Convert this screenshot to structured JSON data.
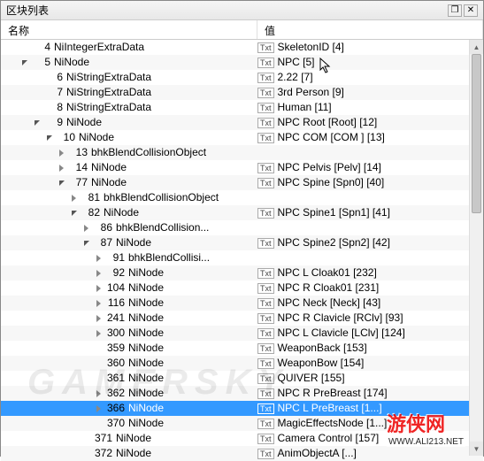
{
  "window": {
    "title": "区块列表"
  },
  "columns": {
    "name": "名称",
    "value": "值"
  },
  "rows": [
    {
      "depth": 1,
      "expand": "none",
      "num": "4",
      "name": "NiIntegerExtraData",
      "tag": "Txt",
      "value": "SkeletonID [4]"
    },
    {
      "depth": 1,
      "expand": "open",
      "num": "5",
      "name": "NiNode",
      "tag": "Txt",
      "value": "NPC [5]"
    },
    {
      "depth": 2,
      "expand": "none",
      "num": "6",
      "name": "NiStringExtraData",
      "tag": "Txt",
      "value": "2.22 [7]"
    },
    {
      "depth": 2,
      "expand": "none",
      "num": "7",
      "name": "NiStringExtraData",
      "tag": "Txt",
      "value": "3rd Person [9]"
    },
    {
      "depth": 2,
      "expand": "none",
      "num": "8",
      "name": "NiStringExtraData",
      "tag": "Txt",
      "value": "Human [11]"
    },
    {
      "depth": 2,
      "expand": "open",
      "num": "9",
      "name": "NiNode",
      "tag": "Txt",
      "value": "NPC Root [Root] [12]"
    },
    {
      "depth": 3,
      "expand": "open",
      "num": "10",
      "name": "NiNode",
      "tag": "Txt",
      "value": "NPC COM [COM ] [13]"
    },
    {
      "depth": 4,
      "expand": "closed",
      "num": "13",
      "name": "bhkBlendCollisionObject",
      "tag": "",
      "value": ""
    },
    {
      "depth": 4,
      "expand": "closed",
      "num": "14",
      "name": "NiNode",
      "tag": "Txt",
      "value": "NPC Pelvis [Pelv] [14]"
    },
    {
      "depth": 4,
      "expand": "open",
      "num": "77",
      "name": "NiNode",
      "tag": "Txt",
      "value": "NPC Spine [Spn0] [40]"
    },
    {
      "depth": 5,
      "expand": "closed",
      "num": "81",
      "name": "bhkBlendCollisionObject",
      "tag": "",
      "value": ""
    },
    {
      "depth": 5,
      "expand": "open",
      "num": "82",
      "name": "NiNode",
      "tag": "Txt",
      "value": "NPC Spine1 [Spn1] [41]"
    },
    {
      "depth": 6,
      "expand": "closed",
      "num": "86",
      "name": "bhkBlendCollision...",
      "tag": "",
      "value": ""
    },
    {
      "depth": 6,
      "expand": "open",
      "num": "87",
      "name": "NiNode",
      "tag": "Txt",
      "value": "NPC Spine2 [Spn2] [42]"
    },
    {
      "depth": 7,
      "expand": "closed",
      "num": "91",
      "name": "bhkBlendCollisi...",
      "tag": "",
      "value": ""
    },
    {
      "depth": 7,
      "expand": "closed",
      "num": "92",
      "name": "NiNode",
      "tag": "Txt",
      "value": "NPC L Cloak01 [232]"
    },
    {
      "depth": 7,
      "expand": "closed",
      "num": "104",
      "name": "NiNode",
      "tag": "Txt",
      "value": "NPC R Cloak01 [231]"
    },
    {
      "depth": 7,
      "expand": "closed",
      "num": "116",
      "name": "NiNode",
      "tag": "Txt",
      "value": "NPC Neck [Neck] [43]"
    },
    {
      "depth": 7,
      "expand": "closed",
      "num": "241",
      "name": "NiNode",
      "tag": "Txt",
      "value": "NPC R Clavicle [RClv] [93]"
    },
    {
      "depth": 7,
      "expand": "closed",
      "num": "300",
      "name": "NiNode",
      "tag": "Txt",
      "value": "NPC L Clavicle [LClv] [124]"
    },
    {
      "depth": 7,
      "expand": "none",
      "num": "359",
      "name": "NiNode",
      "tag": "Txt",
      "value": "WeaponBack [153]"
    },
    {
      "depth": 7,
      "expand": "none",
      "num": "360",
      "name": "NiNode",
      "tag": "Txt",
      "value": "WeaponBow [154]"
    },
    {
      "depth": 7,
      "expand": "none",
      "num": "361",
      "name": "NiNode",
      "tag": "Txt",
      "value": "QUIVER [155]"
    },
    {
      "depth": 7,
      "expand": "closed",
      "num": "362",
      "name": "NiNode",
      "tag": "Txt",
      "value": "NPC R PreBreast [174]"
    },
    {
      "depth": 7,
      "expand": "closed",
      "num": "366",
      "name": "NiNode",
      "tag": "Txt",
      "value": "NPC L PreBreast [1...]",
      "selected": true
    },
    {
      "depth": 7,
      "expand": "none",
      "num": "370",
      "name": "NiNode",
      "tag": "Txt",
      "value": "MagicEffectsNode [1...]"
    },
    {
      "depth": 6,
      "expand": "none",
      "num": "371",
      "name": "NiNode",
      "tag": "Txt",
      "value": "Camera Control [157]"
    },
    {
      "depth": 6,
      "expand": "none",
      "num": "372",
      "name": "NiNode",
      "tag": "Txt",
      "value": "AnimObjectA [...]"
    }
  ],
  "watermark": {
    "text": "GAMERSKY",
    "logo": "游侠网",
    "url": "WWW.ALI213.NET"
  }
}
